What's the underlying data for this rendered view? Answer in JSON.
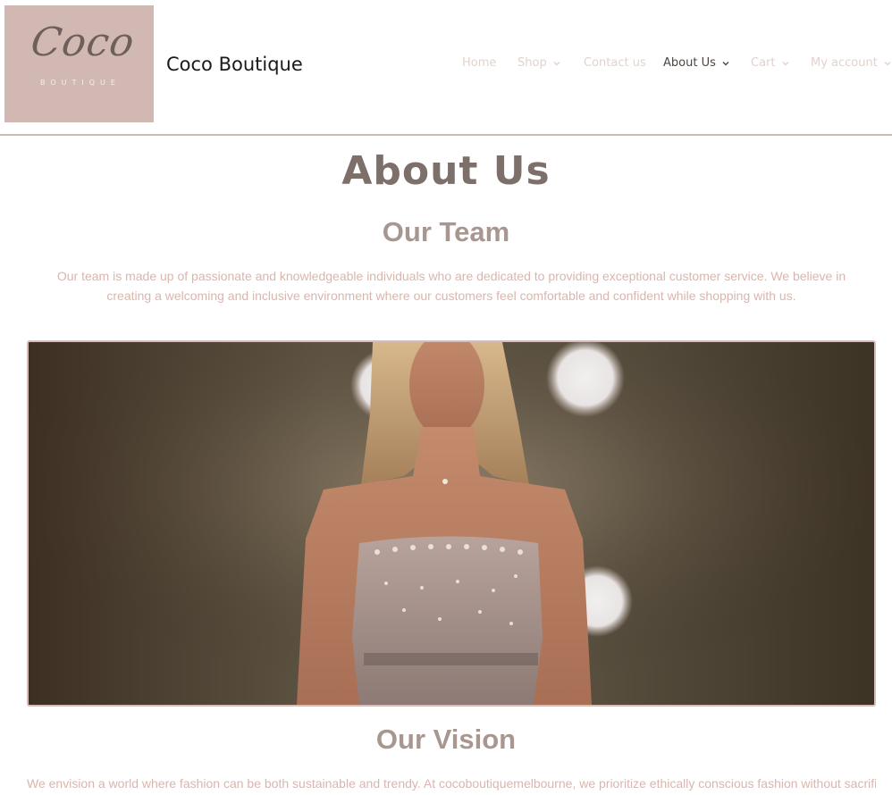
{
  "site": {
    "logo_script": "Coco",
    "logo_subtitle": "BOUTIQUE",
    "title": "Coco Boutique"
  },
  "nav": {
    "items": [
      {
        "label": "Home",
        "dropdown": false,
        "active": false
      },
      {
        "label": "Shop",
        "dropdown": true,
        "active": false
      },
      {
        "label": "Contact us",
        "dropdown": false,
        "active": false
      },
      {
        "label": "About Us",
        "dropdown": true,
        "active": true
      },
      {
        "label": "Cart",
        "dropdown": true,
        "active": false
      },
      {
        "label": "My account",
        "dropdown": true,
        "active": false
      }
    ]
  },
  "main": {
    "page_title": "About Us",
    "team_heading": "Our Team",
    "team_text": "Our team is made up of passionate and knowledgeable individuals who are dedicated to providing exceptional customer service. We believe in creating a welcoming and inclusive environment where our customers feel comfortable and confident while shopping with us.",
    "vision_heading": "Our Vision",
    "vision_text": "We envision a world where fashion can be both sustainable and trendy. At cocoboutiquemelbourne, we prioritize ethically conscious fashion without sacrificing"
  },
  "colors": {
    "logo_bg": "#d2b8b2",
    "heading": "#7d6f69",
    "subheading": "#a89790",
    "body_text": "#dbb5ad",
    "nav_active": "#4e4440",
    "nav_inactive": "#e2d2cc"
  }
}
